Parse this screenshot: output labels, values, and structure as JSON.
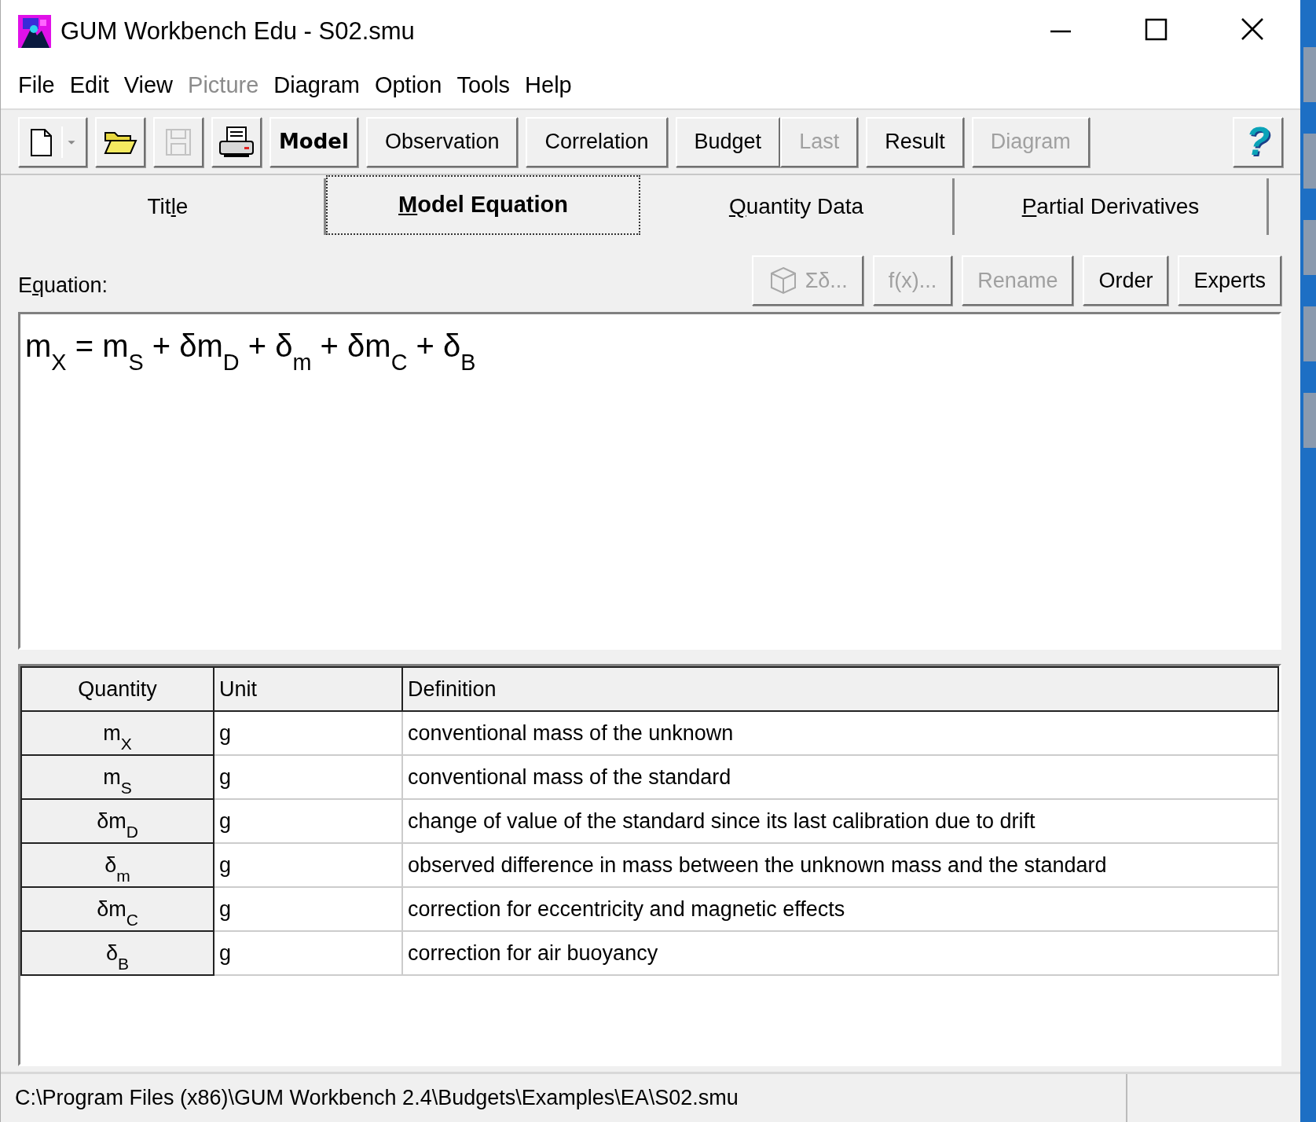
{
  "window": {
    "title": "GUM Workbench Edu - S02.smu"
  },
  "menu": [
    {
      "label": "File",
      "disabled": false
    },
    {
      "label": "Edit",
      "disabled": false
    },
    {
      "label": "View",
      "disabled": false
    },
    {
      "label": "Picture",
      "disabled": true
    },
    {
      "label": "Diagram",
      "disabled": false
    },
    {
      "label": "Option",
      "disabled": false
    },
    {
      "label": "Tools",
      "disabled": false
    },
    {
      "label": "Help",
      "disabled": false
    }
  ],
  "toolbar": [
    {
      "kind": "new"
    },
    {
      "kind": "open"
    },
    {
      "kind": "save",
      "disabled": true
    },
    {
      "kind": "print"
    },
    {
      "kind": "text",
      "label": "Model",
      "selected": true,
      "disabled": false
    },
    {
      "kind": "text",
      "label": "Observation",
      "selected": false,
      "disabled": false
    },
    {
      "kind": "text",
      "label": "Correlation",
      "selected": false,
      "disabled": false
    },
    {
      "kind": "text",
      "label": "Budget",
      "selected": false,
      "disabled": false
    },
    {
      "kind": "attached",
      "label": "Last",
      "selected": false,
      "disabled": true
    },
    {
      "kind": "text",
      "label": "Result",
      "selected": false,
      "disabled": false
    },
    {
      "kind": "text",
      "label": "Diagram",
      "selected": false,
      "disabled": true
    },
    {
      "kind": "help",
      "label": "?"
    }
  ],
  "tabs": [
    {
      "before": "Tit",
      "key": "l",
      "after": "e",
      "selected": false
    },
    {
      "key": "M",
      "after": "odel Equation",
      "selected": true
    },
    {
      "key": "Q",
      "after": "uantity Data",
      "selected": false
    },
    {
      "key": "P",
      "after": "artial Derivatives",
      "selected": false
    }
  ],
  "equation_label": {
    "before": "E",
    "key": "q",
    "after": "uation:"
  },
  "equation_buttons": [
    {
      "kind": "sum",
      "label": "Σδ...",
      "disabled": true
    },
    {
      "kind": "text",
      "label": "f(x)...",
      "disabled": true
    },
    {
      "kind": "text",
      "label": "Rename",
      "disabled": true
    },
    {
      "kind": "text",
      "label": "Order",
      "disabled": false
    },
    {
      "kind": "text",
      "label": "Experts",
      "disabled": false
    }
  ],
  "equation": "m$_{X}$ = m$_{S}$ + δm$_{D}$ + δ$_{m}$ + δm$_{C}$ + δ$_{B}$",
  "table": {
    "columns": [
      "Quantity",
      "Unit",
      "Definition"
    ],
    "rows": [
      {
        "quantity": "m$_{X}$",
        "unit": "g",
        "definition": "conventional mass of the unknown"
      },
      {
        "quantity": "m$_{S}$",
        "unit": "g",
        "definition": "conventional mass of the standard"
      },
      {
        "quantity": "δm$_{D}$",
        "unit": "g",
        "definition": "change of value of the standard since its last calibration due to drift"
      },
      {
        "quantity": "δ$_{m}$",
        "unit": "g",
        "definition": "observed difference in mass between the unknown mass and the standard"
      },
      {
        "quantity": "δm$_{C}$",
        "unit": "g",
        "definition": "correction for eccentricity and magnetic effects"
      },
      {
        "quantity": "δ$_{B}$",
        "unit": "g",
        "definition": "correction for air buoyancy"
      }
    ]
  },
  "status_bar": {
    "path": "C:\\Program Files (x86)\\GUM Workbench 2.4\\Budgets\\Examples\\EA\\S02.smu"
  }
}
